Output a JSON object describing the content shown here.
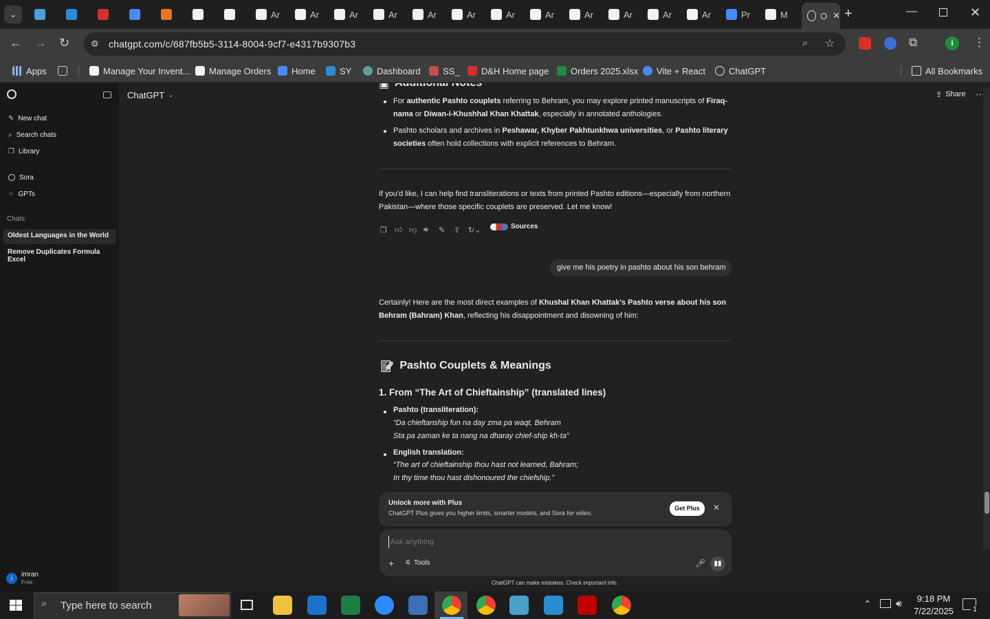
{
  "browser": {
    "tabs": [
      {
        "label": "",
        "icon": "tab-icon"
      },
      {
        "label": "",
        "icon": "ecommerce-icon"
      },
      {
        "label": "",
        "icon": "dh-icon"
      },
      {
        "label": "",
        "icon": "doc-icon"
      },
      {
        "label": "",
        "icon": "store-icon"
      },
      {
        "label": "",
        "icon": "amazon-icon"
      },
      {
        "label": "",
        "icon": "amazon-icon"
      },
      {
        "label": "Ar",
        "icon": "amazon-icon"
      },
      {
        "label": "Ar",
        "icon": "amazon-icon"
      },
      {
        "label": "Ar",
        "icon": "amazon-icon"
      },
      {
        "label": "Ar",
        "icon": "amazon-icon"
      },
      {
        "label": "Ar",
        "icon": "amazon-icon"
      },
      {
        "label": "Ar",
        "icon": "amazon-icon"
      },
      {
        "label": "Ar",
        "icon": "amazon-icon"
      },
      {
        "label": "Ar",
        "icon": "amazon-icon"
      },
      {
        "label": "Ar",
        "icon": "amazon-icon"
      },
      {
        "label": "Ar",
        "icon": "amazon-icon"
      },
      {
        "label": "Ar",
        "icon": "amazon-icon"
      },
      {
        "label": "Ar",
        "icon": "amazon-icon"
      },
      {
        "label": "Pr",
        "icon": "dollar-icon"
      },
      {
        "label": "M",
        "icon": "amazon-icon"
      },
      {
        "label": "O",
        "icon": "chatgpt-icon"
      }
    ],
    "url": "chatgpt.com/c/687fb5b5-3114-8004-9cf7-e4317b9307b3",
    "bookmarks": [
      {
        "label": "Apps"
      },
      {
        "label": ""
      },
      {
        "label": "Manage Your Invent..."
      },
      {
        "label": "Manage Orders"
      },
      {
        "label": "Home"
      },
      {
        "label": "SY"
      },
      {
        "label": "Dashboard"
      },
      {
        "label": "SS_"
      },
      {
        "label": "D&H Home page"
      },
      {
        "label": "Orders 2025.xlsx"
      },
      {
        "label": "Vite + React"
      },
      {
        "label": "ChatGPT"
      }
    ],
    "all_bookmarks": "All Bookmarks",
    "profile_initial": "i"
  },
  "sidebar": {
    "new_chat": "New chat",
    "search_chats": "Search chats",
    "library": "Library",
    "sora": "Sora",
    "gpts": "GPTs",
    "chats_heading": "Chats",
    "chats": [
      "Oldest Languages in the World",
      "Remove Duplicates Formula Excel"
    ],
    "user_name": "imran",
    "user_plan": "Free",
    "user_initial": "i"
  },
  "header": {
    "model": "ChatGPT",
    "share": "Share"
  },
  "conversation": {
    "section_heading": "Additional Notes",
    "bullets": [
      {
        "parts": [
          [
            "For ",
            false
          ],
          [
            "authentic Pashto couplets",
            true
          ],
          [
            " referring to Behram, you may explore printed manuscripts of ",
            false
          ],
          [
            "Firaq-nama",
            true
          ],
          [
            " or ",
            false
          ],
          [
            "Diwan-i-Khushhal Khan Khattak",
            true
          ],
          [
            ", especially in annotated anthologies.",
            false
          ]
        ]
      },
      {
        "parts": [
          [
            "Pashto scholars and archives in ",
            false
          ],
          [
            "Peshawar, Khyber Pakhtunkhwa universities",
            true
          ],
          [
            ", or ",
            false
          ],
          [
            "Pashto literary societies",
            true
          ],
          [
            " often hold collections with explicit references to Behram.",
            false
          ]
        ]
      }
    ],
    "closing": "If you'd like, I can help find transliterations or texts from printed Pashto editions—especially from northern Pakistan—where those specific couplets are preserved. Let me know!",
    "sources_label": "Sources",
    "user_message": "give me his poetry in pashto about his son behram",
    "reply_intro": [
      [
        "Certainly! Here are the most direct examples of ",
        false
      ],
      [
        "Khushal Khan Khattak's Pashto verse about his son Behram (Bahram) Khan",
        true
      ],
      [
        ", reflecting his disappointment and disowning of him:",
        false
      ]
    ],
    "couplets_heading": "Pashto Couplets & Meanings",
    "couplet_1_heading": "1. From “The Art of Chieftainship” (translated lines)",
    "translit_label": "Pashto (transliteration):",
    "translit_lines": [
      "“Da chieftanship fun na day zma pa waqt, Behram",
      "Sta pa zaman ke ta nang na dharay chief-ship kh-ta”"
    ],
    "english_label": "English translation:",
    "english_lines": [
      "“The art of chieftainship thou hast not learned, Bahram;",
      "In thy time thou hast dishonoured the chiefship.”"
    ]
  },
  "upsell": {
    "title": "Unlock more with Plus",
    "desc": "ChatGPT Plus gives you higher limits, smarter models, and Sora for video.",
    "button": "Get Plus"
  },
  "composer": {
    "placeholder": "Ask anything",
    "tools": "Tools",
    "disclaimer": "ChatGPT can make mistakes. Check important info."
  },
  "taskbar": {
    "search_placeholder": "Type here to search",
    "time": "9:18 PM",
    "date": "7/22/2025",
    "notification_count": "1"
  }
}
